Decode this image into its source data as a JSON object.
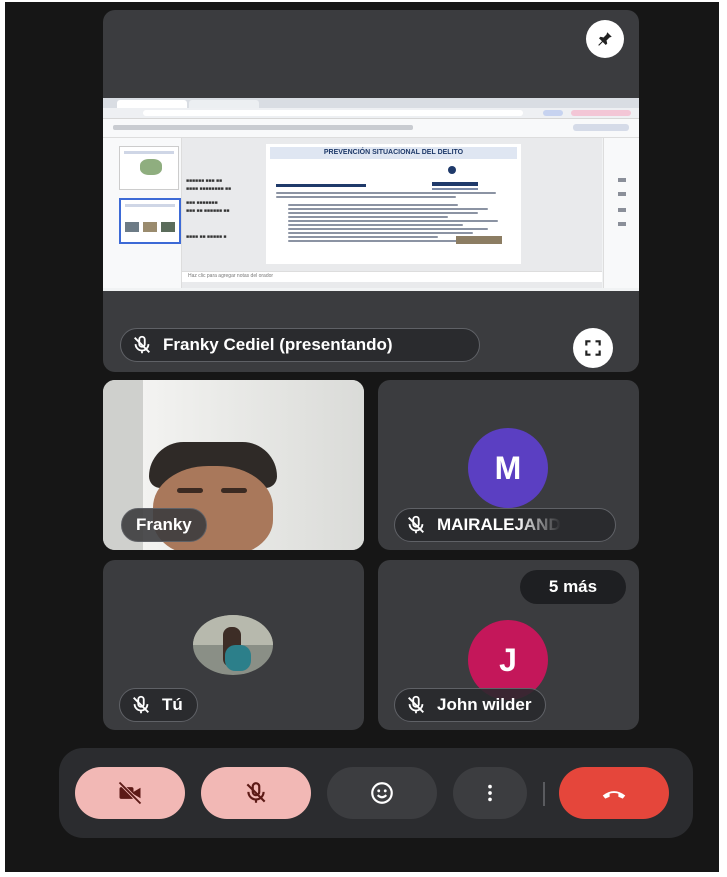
{
  "presentation": {
    "presenter_label": "Franky Cediel (presentando)",
    "pin_icon": "pin-icon",
    "fullscreen_icon": "fullscreen-icon",
    "slide_title": "PREVENCIÓN SITUACIONAL DEL DELITO",
    "notes_placeholder": "Haz clic para agregar notas del orador"
  },
  "participants": {
    "franky": {
      "name": "Franky"
    },
    "maira": {
      "name": "MAIRALEJAND",
      "initial": "M",
      "color": "#5b3fc2"
    },
    "self": {
      "name": "Tú"
    },
    "john": {
      "name": "John wilder",
      "initial": "J",
      "color": "#c4175a"
    },
    "more_label": "5 más"
  },
  "controls": {
    "camera": {
      "icon": "camera-off-icon",
      "color": "#f2b8b5"
    },
    "mic": {
      "icon": "mic-off-icon",
      "color": "#f2b8b5"
    },
    "reactions": {
      "icon": "emoji-icon"
    },
    "more": {
      "icon": "more-vert-icon"
    },
    "hangup": {
      "icon": "hang-up-icon",
      "color": "#e5463b"
    }
  }
}
